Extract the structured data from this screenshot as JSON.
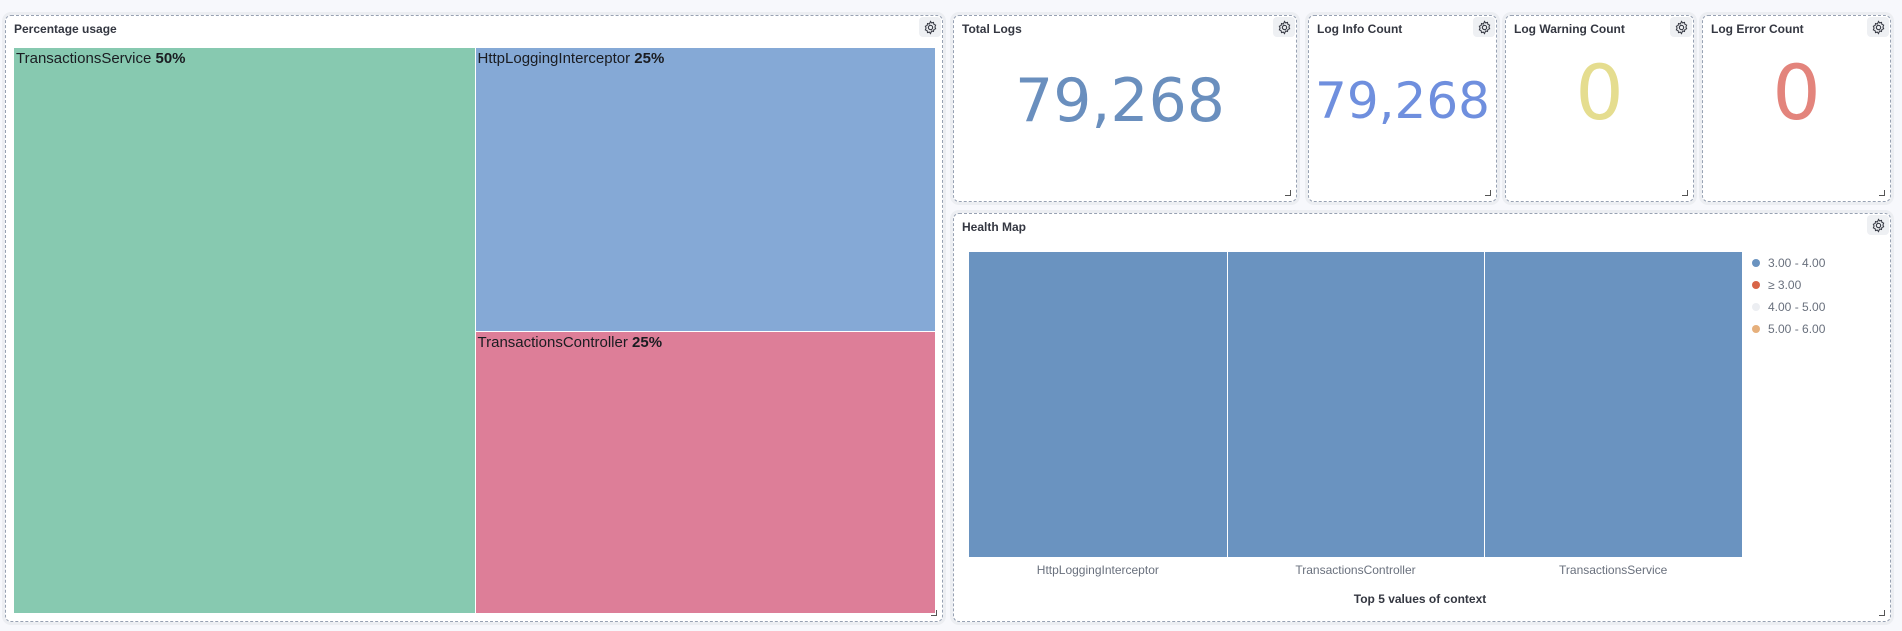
{
  "panels": {
    "percentage_usage": {
      "title": "Percentage usage",
      "treemap": [
        {
          "name": "TransactionsService",
          "pct": "50%",
          "color": "#87c9b0"
        },
        {
          "name": "HttpLoggingInterceptor",
          "pct": "25%",
          "color": "#85a9d6"
        },
        {
          "name": "TransactionsController",
          "pct": "25%",
          "color": "#dd7e98"
        }
      ]
    },
    "total_logs": {
      "title": "Total Logs",
      "value": "79,268",
      "color": "#6a8fbe"
    },
    "log_info": {
      "title": "Log Info Count",
      "value": "79,268",
      "color": "#6f8fde"
    },
    "log_warning": {
      "title": "Log Warning Count",
      "value": "0",
      "color": "#e5dd8f"
    },
    "log_error": {
      "title": "Log Error Count",
      "value": "0",
      "color": "#e3847c"
    },
    "health_map": {
      "title": "Health Map",
      "x_title": "Top 5 values of context",
      "legend": [
        {
          "label": "3.00 - 4.00",
          "color": "#6a93c0"
        },
        {
          "label": "≥ 3.00",
          "color": "#d86547"
        },
        {
          "label": "4.00 - 5.00",
          "color": "#eceef2"
        },
        {
          "label": "5.00 - 6.00",
          "color": "#e6b07c"
        }
      ]
    }
  },
  "chart_data": [
    {
      "type": "treemap",
      "title": "Percentage usage",
      "categories": [
        "TransactionsService",
        "HttpLoggingInterceptor",
        "TransactionsController"
      ],
      "values": [
        50,
        25,
        25
      ],
      "unit": "%"
    },
    {
      "type": "heatmap",
      "title": "Health Map",
      "xlabel": "Top 5 values of context",
      "categories": [
        "HttpLoggingInterceptor",
        "TransactionsController",
        "TransactionsService"
      ],
      "bucket": [
        "3.00 - 4.00",
        "3.00 - 4.00",
        "3.00 - 4.00"
      ],
      "legend": [
        "3.00 - 4.00",
        "≥ 3.00",
        "4.00 - 5.00",
        "5.00 - 6.00"
      ],
      "legend_position": "right"
    }
  ]
}
